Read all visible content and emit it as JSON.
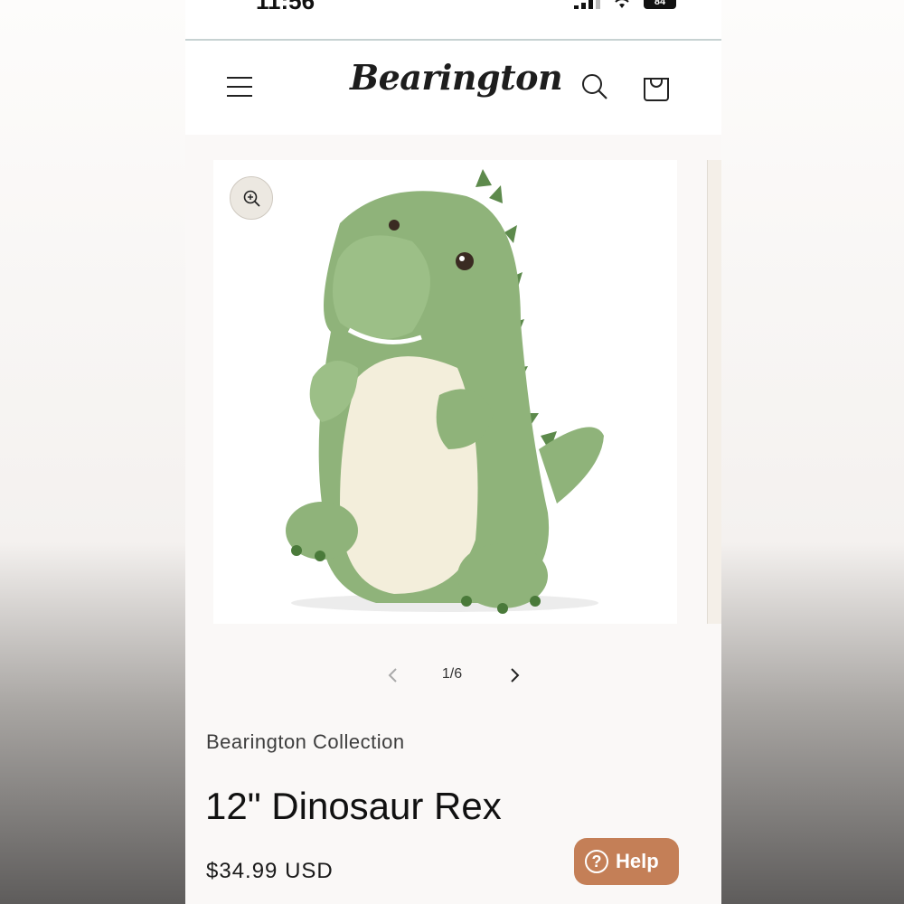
{
  "status_bar": {
    "time": "11:56",
    "battery": "84"
  },
  "header": {
    "brand": "Bearington",
    "icons": {
      "menu": "hamburger-menu-icon",
      "search": "search-icon",
      "cart": "cart-icon"
    }
  },
  "gallery": {
    "image_alt": "Green plush dinosaur with cream belly",
    "zoom_icon": "zoom-in-icon",
    "current": "1/6"
  },
  "product": {
    "vendor": "Bearington Collection",
    "title": "12\" Dinosaur Rex",
    "price": "$34.99 USD"
  },
  "help": {
    "label": "Help",
    "icon": "question-icon"
  },
  "colors": {
    "plush_green": "#8fb37a",
    "belly_cream": "#f3eedb",
    "help_button": "#c47f57"
  }
}
